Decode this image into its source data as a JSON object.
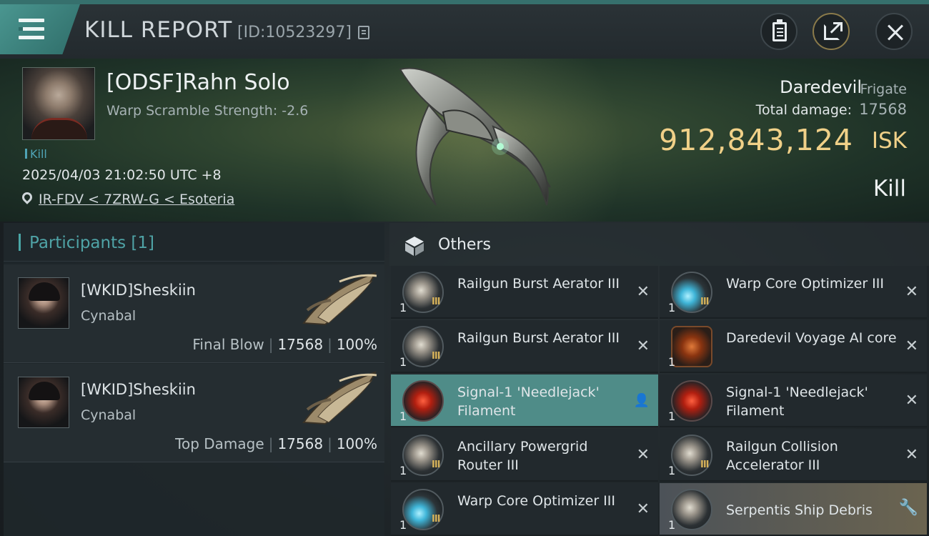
{
  "header": {
    "title": "KILL REPORT",
    "report_id": "[ID:10523297]"
  },
  "victim": {
    "name": "[ODSF]Rahn Solo",
    "warp_scramble": "Warp Scramble Strength: -2.6",
    "tag": "Kill",
    "datetime": "2025/04/03 21:02:50 UTC +8",
    "location": "IR-FDV < 7ZRW-G < Esoteria",
    "ship_name": "Daredevil",
    "ship_class": "Frigate",
    "total_damage_label": "Total damage:",
    "total_damage": "17568",
    "isk_value": "912,843,124",
    "isk_unit": "ISK",
    "result": "Kill"
  },
  "participants": {
    "title": "Participants [1]",
    "rows": [
      {
        "name": "[WKID]Sheskiin",
        "ship": "Cynabal",
        "label": "Final Blow",
        "damage": "17568",
        "percent": "100%"
      },
      {
        "name": "[WKID]Sheskiin",
        "ship": "Cynabal",
        "label": "Top Damage",
        "damage": "17568",
        "percent": "100%"
      }
    ]
  },
  "others": {
    "title": "Others",
    "items": [
      {
        "name": "Railgun Burst Aerator III",
        "qty": "1",
        "meta": "III",
        "icon": "railgun-burst-aerator-icon",
        "action": "✕",
        "state": "destroyed"
      },
      {
        "name": "Warp Core Optimizer III",
        "qty": "1",
        "meta": "III",
        "icon": "warp-core-optimizer-icon",
        "action": "✕",
        "state": "destroyed"
      },
      {
        "name": "Railgun Burst Aerator III",
        "qty": "1",
        "meta": "III",
        "icon": "railgun-burst-aerator-icon",
        "action": "✕",
        "state": "destroyed"
      },
      {
        "name": "Daredevil Voyage AI core",
        "qty": "1",
        "meta": "",
        "icon": "ai-core-icon",
        "action": "✕",
        "state": "destroyed"
      },
      {
        "name": "Signal-1 'Needlejack' Filament",
        "qty": "1",
        "meta": "",
        "icon": "filament-icon",
        "action": "👤",
        "state": "dropped-highlight"
      },
      {
        "name": "Signal-1 'Needlejack' Filament",
        "qty": "1",
        "meta": "",
        "icon": "filament-icon",
        "action": "✕",
        "state": "destroyed"
      },
      {
        "name": "Ancillary Powergrid Router III",
        "qty": "1",
        "meta": "III",
        "icon": "powergrid-router-icon",
        "action": "✕",
        "state": "destroyed"
      },
      {
        "name": "Railgun Collision Accelerator III",
        "qty": "1",
        "meta": "III",
        "icon": "railgun-collision-accelerator-icon",
        "action": "✕",
        "state": "destroyed"
      },
      {
        "name": "Warp Core Optimizer III",
        "qty": "1",
        "meta": "III",
        "icon": "warp-core-optimizer-icon",
        "action": "✕",
        "state": "destroyed"
      },
      {
        "name": "Serpentis Ship Debris",
        "qty": "1",
        "meta": "",
        "icon": "ship-debris-icon",
        "action": "🔧",
        "state": "salvage"
      }
    ]
  },
  "colors": {
    "accent_teal": "#4f8c88",
    "isk_gold": "#f0d088",
    "meta_gold": "#d6b25a",
    "kill_tag_blue": "#4fa3b5"
  }
}
